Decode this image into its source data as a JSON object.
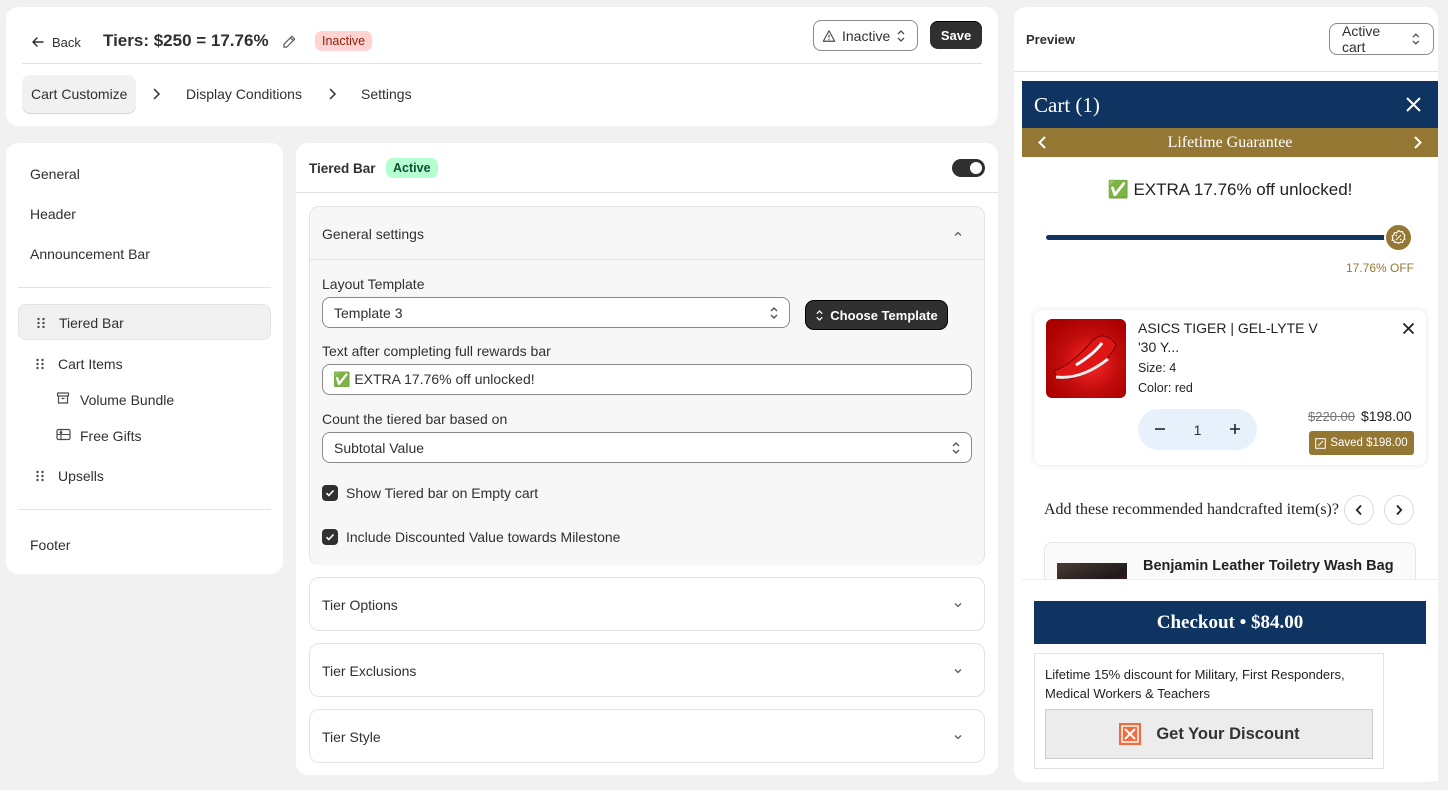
{
  "header": {
    "back_label": "Back",
    "title": "Tiers: $250 = 17.76%",
    "status_badge": "Inactive",
    "status_select": "Inactive",
    "save_label": "Save",
    "steps": [
      "Cart Customize",
      "Display Conditions",
      "Settings"
    ]
  },
  "sidebar": {
    "top_items": [
      "General",
      "Header",
      "Announcement Bar"
    ],
    "blocks": [
      {
        "label": "Tiered Bar"
      },
      {
        "label": "Cart Items"
      },
      {
        "label": "Volume Bundle"
      },
      {
        "label": "Free Gifts"
      },
      {
        "label": "Upsells"
      }
    ],
    "footer_item": "Footer"
  },
  "main": {
    "title": "Tiered Bar",
    "badge": "Active",
    "enabled": true,
    "general": {
      "title": "General settings",
      "layout_label": "Layout Template",
      "layout_value": "Template 3",
      "choose_label": "Choose Template",
      "text_label": "Text after completing full rewards bar",
      "text_value": "✅ EXTRA 17.76% off unlocked!",
      "count_label": "Count the tiered bar based on",
      "count_value": "Subtotal Value",
      "check1": "Show Tiered bar on Empty cart",
      "check1_checked": true,
      "check2": "Include Discounted Value towards Milestone",
      "check2_checked": true
    },
    "collapsed_sections": [
      "Tier Options",
      "Tier Exclusions",
      "Tier Style"
    ]
  },
  "preview": {
    "title": "Preview",
    "select_value": "Active cart",
    "cart": {
      "title": "Cart (1)",
      "announcement": "Lifetime Guarantee",
      "unlocked_text": "✅ EXTRA 17.76% off unlocked!",
      "progress_pct": 100,
      "progress_label": "17.76% OFF",
      "item": {
        "name": "ASICS TIGER | GEL-LYTE V '30 Y...",
        "size": "Size: 4",
        "color": "Color: red",
        "qty": "1",
        "old_price": "$220.00",
        "new_price": "$198.00",
        "saved": "Saved $198.00"
      },
      "recommend_title": "Add these recommended handcrafted item(s)?",
      "recommend_item": "Benjamin Leather Toiletry Wash Bag",
      "checkout": "Checkout • $84.00",
      "discount_text": "Lifetime 15% discount for Military, First Responders, Medical Workers & Teachers",
      "discount_button": "Get Your Discount"
    }
  },
  "colors": {
    "navy": "#0f3461",
    "gold": "#957734",
    "dark_button": "#303030",
    "active_badge_bg": "#b4fed2",
    "inactive_badge_bg": "#fed3d1"
  }
}
